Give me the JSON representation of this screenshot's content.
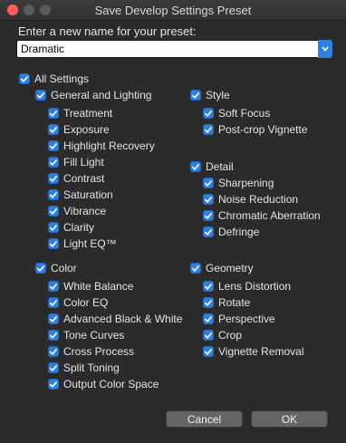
{
  "window": {
    "title": "Save Develop Settings Preset"
  },
  "prompt": "Enter a new name for your preset:",
  "preset_name": {
    "value": "Dramatic"
  },
  "all_settings": {
    "label": "All Settings",
    "checked": true
  },
  "groups": {
    "general": {
      "label": "General and Lighting",
      "items": [
        "Treatment",
        "Exposure",
        "Highlight Recovery",
        "Fill Light",
        "Contrast",
        "Saturation",
        "Vibrance",
        "Clarity",
        "Light EQ™"
      ]
    },
    "color": {
      "label": "Color",
      "items": [
        "White Balance",
        "Color EQ",
        "Advanced Black & White",
        "Tone Curves",
        "Cross Process",
        "Split Toning",
        "Output Color Space"
      ]
    },
    "style": {
      "label": "Style",
      "items": [
        "Soft Focus",
        "Post-crop Vignette"
      ]
    },
    "detail": {
      "label": "Detail",
      "items": [
        "Sharpening",
        "Noise Reduction",
        "Chromatic Aberration",
        "Defringe"
      ]
    },
    "geometry": {
      "label": "Geometry",
      "items": [
        "Lens Distortion",
        "Rotate",
        "Perspective",
        "Crop",
        "Vignette Removal"
      ]
    }
  },
  "buttons": {
    "cancel": "Cancel",
    "ok": "OK"
  },
  "colors": {
    "accent": "#2f7fe0",
    "background": "#2b2b2b"
  }
}
